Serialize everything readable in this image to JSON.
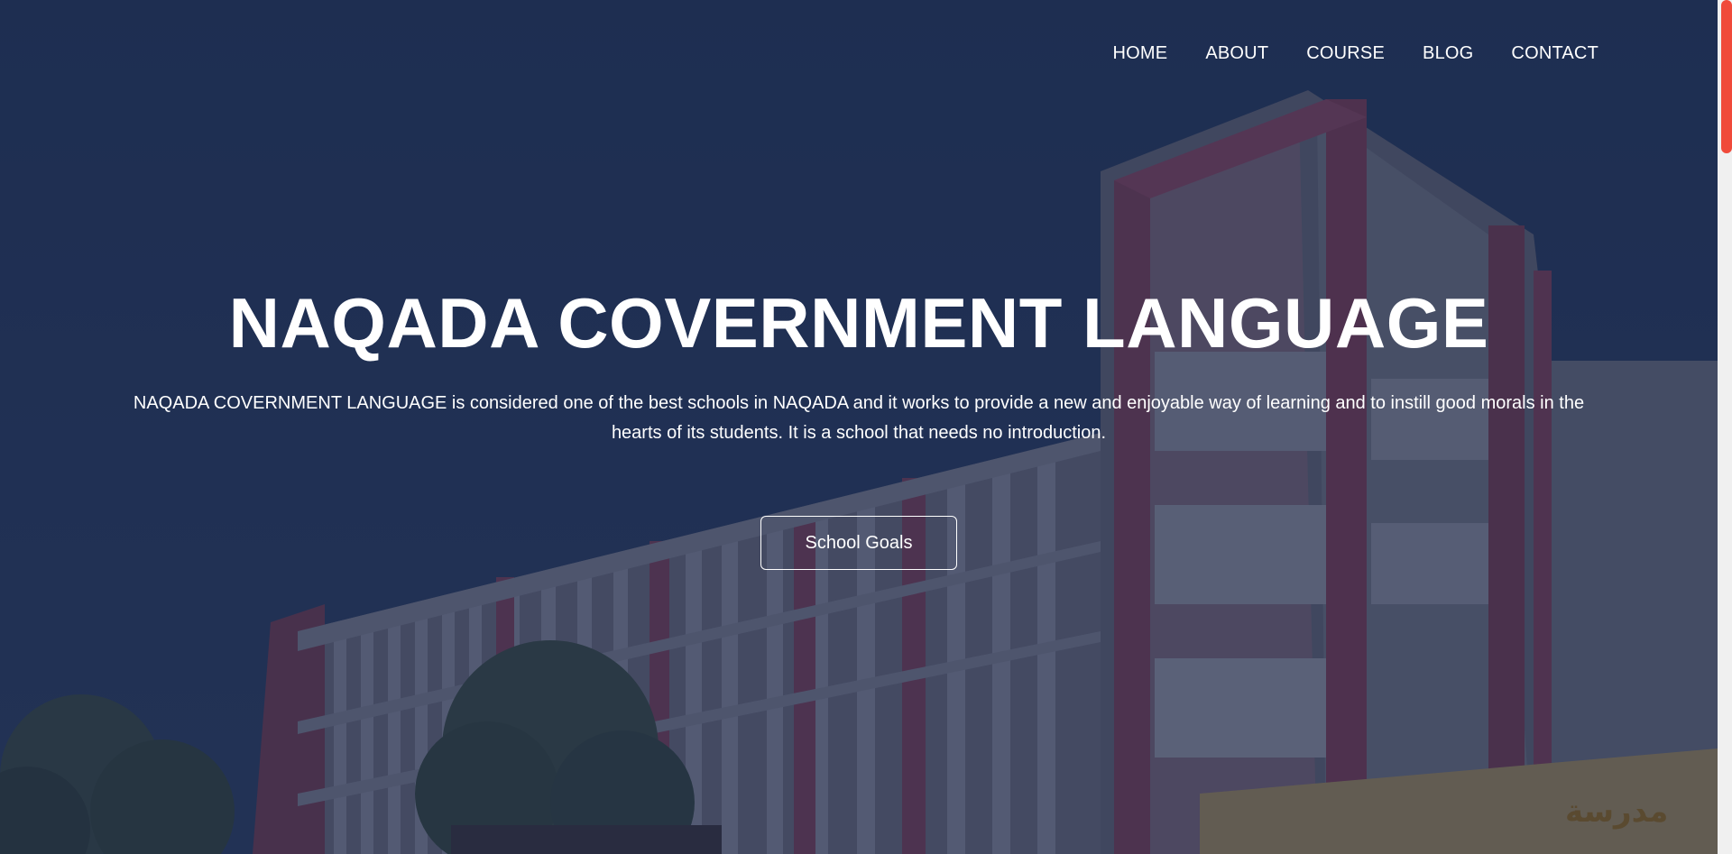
{
  "nav": {
    "items": [
      "HOME",
      "ABOUT",
      "COURSE",
      "BLOG",
      "CONTACT"
    ]
  },
  "hero": {
    "title": "NAQADA COVERNMENT LANGUAGE",
    "description": "NAQADA COVERNMENT LANGUAGE is considered one of the best schools in NAQADA and it works to provide a new and enjoyable way of learning and to instill good morals in the hearts of its students. It is a school that needs no introduction.",
    "button_label": "School Goals",
    "sign_text": "مدرسة"
  },
  "colors": {
    "overlay": "#1c2a4a",
    "accent_scrollbar": "#f04a3a",
    "text": "#ffffff"
  }
}
